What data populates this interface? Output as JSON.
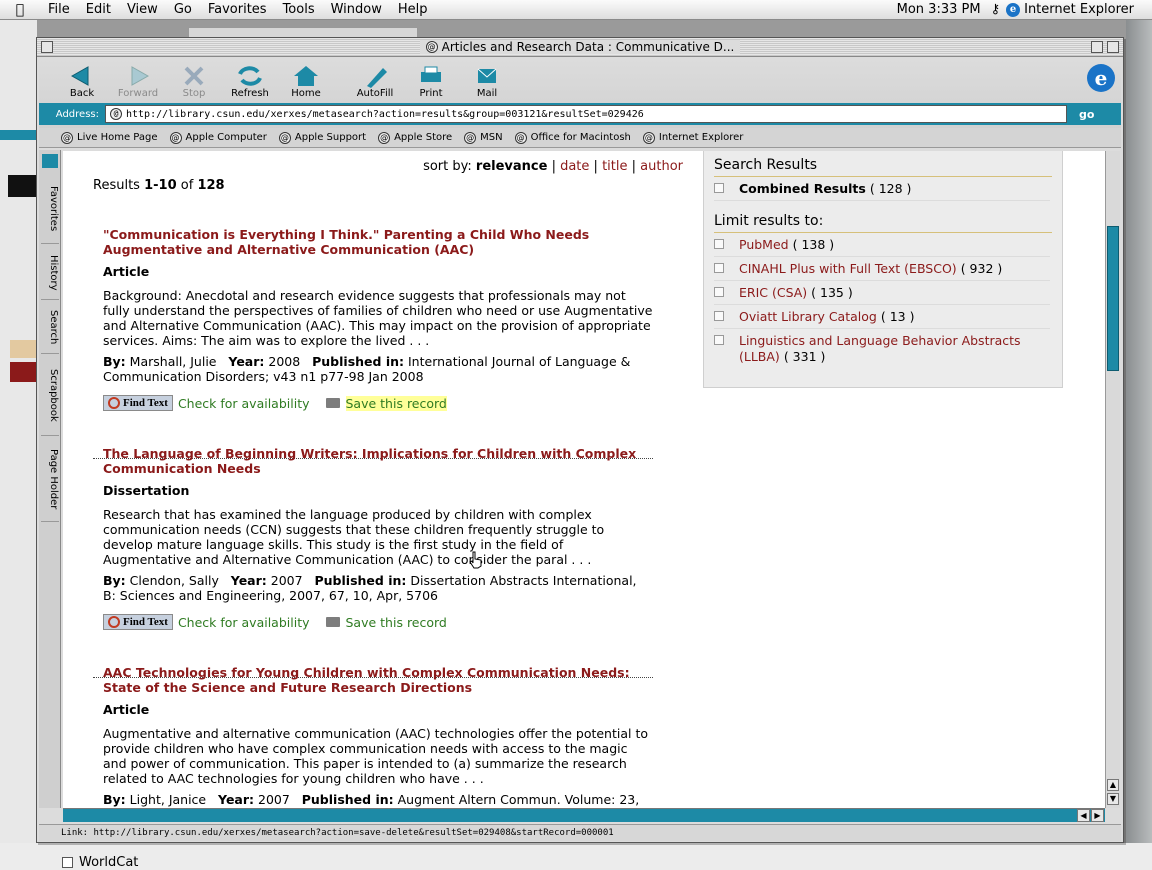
{
  "menubar": {
    "items": [
      "File",
      "Edit",
      "View",
      "Go",
      "Favorites",
      "Tools",
      "Window",
      "Help"
    ],
    "clock": "Mon 3:33 PM",
    "app_name": "Internet Explorer"
  },
  "window": {
    "title": "Articles and Research Data  : Communicative D..."
  },
  "toolbar": {
    "back": "Back",
    "forward": "Forward",
    "stop": "Stop",
    "refresh": "Refresh",
    "home": "Home",
    "autofill": "AutoFill",
    "print": "Print",
    "mail": "Mail"
  },
  "address": {
    "label": "Address:",
    "url": "http://library.csun.edu/xerxes/metasearch?action=results&group=003121&resultSet=029426",
    "go": "go"
  },
  "favorites": [
    "Live Home Page",
    "Apple Computer",
    "Apple Support",
    "Apple Store",
    "MSN",
    "Office for Macintosh",
    "Internet Explorer"
  ],
  "sidebar_tabs": [
    "Favorites",
    "History",
    "Search",
    "Scrapbook",
    "Page Holder"
  ],
  "sort": {
    "label": "sort by:",
    "current": "relevance",
    "options": [
      "date",
      "title",
      "author"
    ]
  },
  "results_summary": {
    "prefix": "Results",
    "range": "1-10",
    "of": "of",
    "total": "128"
  },
  "labels": {
    "by": "By:",
    "year": "Year:",
    "published": "Published in:",
    "find_text": "Find Text",
    "check": "Check for availability",
    "save": "Save this record"
  },
  "records": [
    {
      "title": "\"Communication is Everything I Think.\" Parenting a Child Who Needs Augmentative and Alternative Communication (AAC)",
      "type": "Article",
      "abstract": "Background: Anecdotal and research evidence suggests that professionals may not fully understand the perspectives of families of children who need or use Augmentative and Alternative Communication (AAC). This may impact on the provision of appropriate services. Aims: The aim was to explore the lived . . .",
      "author": "Marshall, Julie",
      "year": "2008",
      "published": "International Journal of Language & Communication Disorders; v43 n1 p77-98 Jan 2008"
    },
    {
      "title": "The Language of Beginning Writers: Implications for Children with Complex Communication Needs",
      "type": "Dissertation",
      "abstract": "Research that has examined the language produced by children with complex communication needs (CCN) suggests that these children frequently struggle to develop mature language skills. This study is the first study in the field of Augmentative and Alternative Communication (AAC) to consider the paral . . .",
      "author": "Clendon, Sally",
      "year": "2007",
      "published": "Dissertation Abstracts International, B: Sciences and Engineering, 2007, 67, 10, Apr, 5706"
    },
    {
      "title": "AAC Technologies for Young Children with Complex Communication Needs: State of the Science and Future Research Directions",
      "type": "Article",
      "abstract": "Augmentative and alternative communication (AAC) technologies offer the potential to provide children who have complex communication needs with access to the magic and power of communication. This paper is intended to (a) summarize the research related to AAC technologies for young children who have . . .",
      "author": "Light, Janice",
      "year": "2007",
      "published": "Augment Altern Commun. Volume: 23,"
    }
  ],
  "panel": {
    "heading": "Search Results",
    "combined_label": "Combined Results",
    "combined_count": "( 128 )",
    "limit_heading": "Limit results to:",
    "databases": [
      {
        "name": "PubMed",
        "count": "( 138 )"
      },
      {
        "name": "CINAHL Plus with Full Text (EBSCO)",
        "count": "( 932 )"
      },
      {
        "name": "ERIC (CSA)",
        "count": "( 135 )"
      },
      {
        "name": "Oviatt Library Catalog",
        "count": "( 13 )"
      },
      {
        "name": "Linguistics and Language Behavior Abstracts (LLBA)",
        "count": "( 331 )"
      }
    ]
  },
  "status": {
    "text": "Link: http://library.csun.edu/xerxes/metasearch?action=save-delete&resultSet=029408&startRecord=000001"
  },
  "below": {
    "worldcat": "WorldCat"
  },
  "colors": {
    "accent": "#1d8aa6",
    "link": "#8b1a1a",
    "action": "#2f7b22"
  }
}
